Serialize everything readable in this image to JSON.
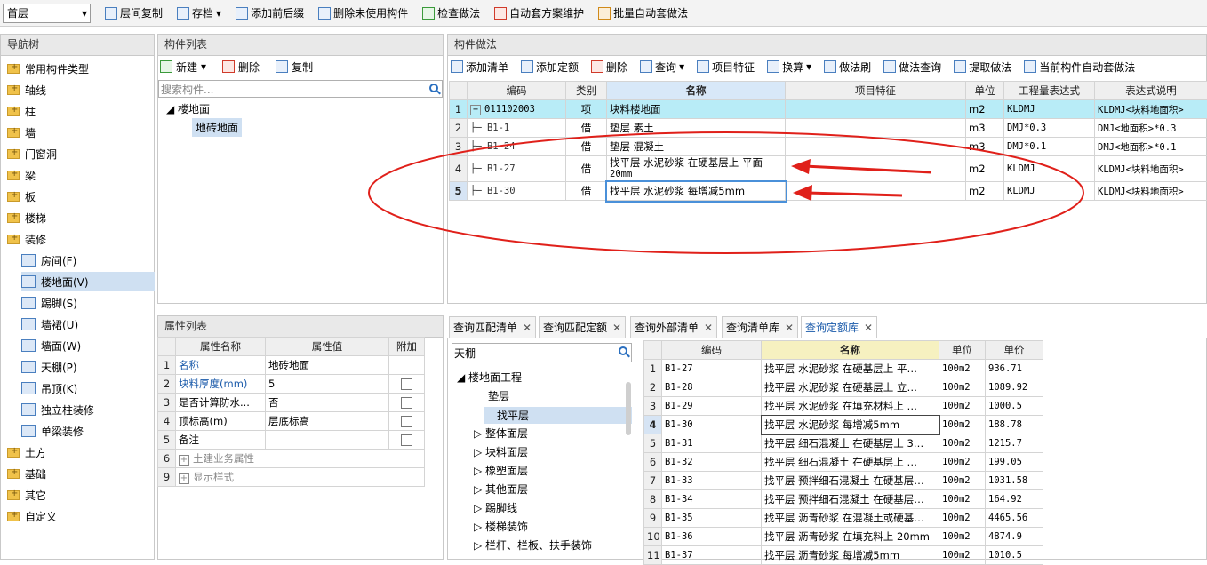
{
  "toolbar": {
    "floor_select": "首层",
    "items": [
      {
        "label": "层间复制",
        "icon": "copy-floor-icon"
      },
      {
        "label": "存档",
        "icon": "archive-icon",
        "dropdown": true
      },
      {
        "label": "添加前后缀",
        "icon": "add-prefix-icon"
      },
      {
        "label": "删除未使用构件",
        "icon": "delete-unused-icon"
      },
      {
        "label": "检查做法",
        "icon": "check-method-icon"
      },
      {
        "label": "自动套方案维护",
        "icon": "auto-scheme-icon"
      },
      {
        "label": "批量自动套做法",
        "icon": "batch-auto-icon"
      }
    ]
  },
  "nav": {
    "title": "导航树",
    "items": [
      {
        "label": "常用构件类型",
        "type": "folder"
      },
      {
        "label": "轴线",
        "type": "folder"
      },
      {
        "label": "柱",
        "type": "folder"
      },
      {
        "label": "墙",
        "type": "folder"
      },
      {
        "label": "门窗洞",
        "type": "folder"
      },
      {
        "label": "梁",
        "type": "folder"
      },
      {
        "label": "板",
        "type": "folder"
      },
      {
        "label": "楼梯",
        "type": "folder"
      },
      {
        "label": "装修",
        "type": "folder-open"
      },
      {
        "label": "房间(F)",
        "type": "child"
      },
      {
        "label": "楼地面(V)",
        "type": "child",
        "selected": true
      },
      {
        "label": "踢脚(S)",
        "type": "child"
      },
      {
        "label": "墙裙(U)",
        "type": "child"
      },
      {
        "label": "墙面(W)",
        "type": "child"
      },
      {
        "label": "天棚(P)",
        "type": "child"
      },
      {
        "label": "吊顶(K)",
        "type": "child"
      },
      {
        "label": "独立柱装修",
        "type": "child"
      },
      {
        "label": "单梁装修",
        "type": "child"
      },
      {
        "label": "土方",
        "type": "folder"
      },
      {
        "label": "基础",
        "type": "folder"
      },
      {
        "label": "其它",
        "type": "folder"
      },
      {
        "label": "自定义",
        "type": "folder"
      }
    ]
  },
  "comp_list": {
    "title": "构件列表",
    "new_label": "新建",
    "delete_label": "删除",
    "copy_label": "复制",
    "search_placeholder": "搜索构件...",
    "tree_root": "楼地面",
    "tree_child": "地砖地面"
  },
  "props": {
    "title": "属性列表",
    "headers": [
      "属性名称",
      "属性值",
      "附加"
    ],
    "rows": [
      {
        "n": "1",
        "name": "名称",
        "value": "地砖地面",
        "check": false,
        "blue": true
      },
      {
        "n": "2",
        "name": "块料厚度(mm)",
        "value": "5",
        "check": true,
        "blue": true
      },
      {
        "n": "3",
        "name": "是否计算防水...",
        "value": "否",
        "check": true,
        "blue": false
      },
      {
        "n": "4",
        "name": "顶标高(m)",
        "value": "层底标高",
        "check": true,
        "blue": false
      },
      {
        "n": "5",
        "name": "备注",
        "value": "",
        "check": true,
        "blue": false
      },
      {
        "n": "6",
        "name": "土建业务属性",
        "value": "",
        "group": true
      },
      {
        "n": "9",
        "name": "显示样式",
        "value": "",
        "group": true
      }
    ]
  },
  "method": {
    "title": "构件做法",
    "toolbar": [
      "添加清单",
      "添加定额",
      "删除",
      "查询",
      "项目特征",
      "换算",
      "做法刷",
      "做法查询",
      "提取做法",
      "当前构件自动套做法"
    ],
    "headers": [
      "编码",
      "类别",
      "名称",
      "项目特征",
      "单位",
      "工程量表达式",
      "表达式说明"
    ],
    "rows": [
      {
        "n": "1",
        "code": "011102003",
        "type": "项",
        "name": "块料楼地面",
        "name2": "",
        "unit": "m2",
        "expr": "KLDMJ",
        "desc": "KLDMJ<块料地面积>",
        "parent": true
      },
      {
        "n": "2",
        "code": "B1-1",
        "type": "借",
        "name": "垫层 素土",
        "name2": "",
        "unit": "m3",
        "expr": "DMJ*0.3",
        "desc": "DMJ<地面积>*0.3"
      },
      {
        "n": "3",
        "code": "B1-24",
        "type": "借",
        "name": "垫层 混凝土",
        "name2": "",
        "unit": "m3",
        "expr": "DMJ*0.1",
        "desc": "DMJ<地面积>*0.1"
      },
      {
        "n": "4",
        "code": "B1-27",
        "type": "借",
        "name": "找平层 水泥砂浆 在硬基层上 平面",
        "name2": "20mm",
        "unit": "m2",
        "expr": "KLDMJ",
        "desc": "KLDMJ<块料地面积>"
      },
      {
        "n": "5",
        "code": "B1-30",
        "type": "借",
        "name": "找平层 水泥砂浆 每增减5mm",
        "name2": "",
        "unit": "m2",
        "expr": "KLDMJ",
        "desc": "KLDMJ<块料地面积>",
        "current": true
      }
    ]
  },
  "query": {
    "tabs": [
      "查询匹配清单",
      "查询匹配定额",
      "查询外部清单",
      "查询清单库",
      "查询定额库"
    ],
    "search_value": "天棚",
    "tree": [
      {
        "label": "楼地面工程",
        "level": 0,
        "open": true
      },
      {
        "label": "垫层",
        "level": 1
      },
      {
        "label": "找平层",
        "level": 1,
        "selected": true
      },
      {
        "label": "整体面层",
        "level": 1,
        "collapsed": true
      },
      {
        "label": "块料面层",
        "level": 1,
        "collapsed": true
      },
      {
        "label": "橡塑面层",
        "level": 1,
        "collapsed": true
      },
      {
        "label": "其他面层",
        "level": 1,
        "collapsed": true
      },
      {
        "label": "踢脚线",
        "level": 1,
        "collapsed": true
      },
      {
        "label": "楼梯装饰",
        "level": 1,
        "collapsed": true
      },
      {
        "label": "栏杆、栏板、扶手装饰",
        "level": 1,
        "collapsed": true
      }
    ],
    "headers": [
      "编码",
      "名称",
      "单位",
      "单价"
    ],
    "rows": [
      {
        "n": "1",
        "code": "B1-27",
        "name": "找平层 水泥砂浆 在硬基层上 平…",
        "unit": "100m2",
        "price": "936.71"
      },
      {
        "n": "2",
        "code": "B1-28",
        "name": "找平层 水泥砂浆 在硬基层上 立…",
        "unit": "100m2",
        "price": "1089.92"
      },
      {
        "n": "3",
        "code": "B1-29",
        "name": "找平层 水泥砂浆 在填充材料上 …",
        "unit": "100m2",
        "price": "1000.5"
      },
      {
        "n": "4",
        "code": "B1-30",
        "name": "找平层 水泥砂浆 每增减5mm",
        "unit": "100m2",
        "price": "188.78",
        "current": true
      },
      {
        "n": "5",
        "code": "B1-31",
        "name": "找平层 细石混凝土 在硬基层上 3…",
        "unit": "100m2",
        "price": "1215.7"
      },
      {
        "n": "6",
        "code": "B1-32",
        "name": "找平层 细石混凝土 在硬基层上 …",
        "unit": "100m2",
        "price": "199.05"
      },
      {
        "n": "7",
        "code": "B1-33",
        "name": "找平层 预拌细石混凝土 在硬基层…",
        "unit": "100m2",
        "price": "1031.58"
      },
      {
        "n": "8",
        "code": "B1-34",
        "name": "找平层 预拌细石混凝土 在硬基层…",
        "unit": "100m2",
        "price": "164.92"
      },
      {
        "n": "9",
        "code": "B1-35",
        "name": "找平层 沥青砂浆 在混凝土或硬基…",
        "unit": "100m2",
        "price": "4465.56"
      },
      {
        "n": "10",
        "code": "B1-36",
        "name": "找平层 沥青砂浆 在填充料上 20mm",
        "unit": "100m2",
        "price": "4874.9"
      },
      {
        "n": "11",
        "code": "B1-37",
        "name": "找平层 沥青砂浆 每增减5mm",
        "unit": "100m2",
        "price": "1010.5"
      }
    ]
  },
  "colors": {
    "accent": "#1a5aaa",
    "selected_row": "#b8ecf7",
    "annotation": "#e0201a"
  }
}
